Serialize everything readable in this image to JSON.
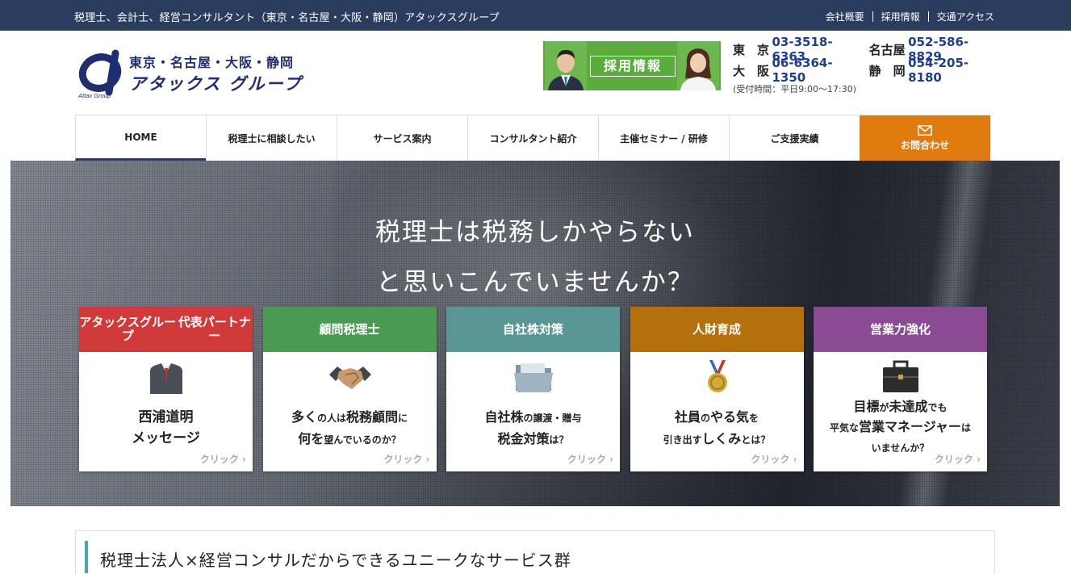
{
  "topbar": {
    "tagline": "税理士、会計士、経営コンサルタント（東京・名古屋・大阪・静岡）アタックスグループ",
    "links": [
      "会社概要",
      "採用情報",
      "交通アクセス"
    ]
  },
  "logo": {
    "mark_text": "Attax Group",
    "region": "東京・名古屋・大阪・静岡",
    "brand": "アタックス グループ"
  },
  "recruit_banner": {
    "label": "採用情報"
  },
  "contacts": {
    "rows": [
      [
        {
          "city": "東　京",
          "tel": "03-3518-6363"
        },
        {
          "city": "名古屋",
          "tel": "052-586-8829"
        }
      ],
      [
        {
          "city": "大　阪",
          "tel": "06-6364-1350"
        },
        {
          "city": "静　岡",
          "tel": "054-205-8180"
        }
      ]
    ],
    "hours": "(受付時間：平日9:00～17:30)"
  },
  "nav": {
    "items": [
      "HOME",
      "税理士に相談したい",
      "サービス案内",
      "コンサルタント紹介",
      "主催セミナー / 研修",
      "ご支援実績"
    ],
    "contact": "お問合わせ",
    "contact_icon": "mail-icon"
  },
  "hero": {
    "line1": "税理士は税務しかやらない",
    "line2": "と思いこんでいませんか？"
  },
  "cards": [
    {
      "head_lines": [
        "アタックスグループ",
        "代表パートナー"
      ],
      "color": "#d03a3a",
      "icon": "suit-icon",
      "body_html_lines": [
        [
          {
            "t": "西浦道明",
            "s": 17
          }
        ],
        [
          {
            "t": "メッセージ",
            "s": 17
          }
        ]
      ]
    },
    {
      "head_lines": [
        "顧問税理士"
      ],
      "color": "#4a9a52",
      "icon": "handshake-icon",
      "body_html_lines": [
        [
          {
            "t": "多く",
            "s": 16
          },
          {
            "t": "の人は",
            "s": 12
          },
          {
            "t": "税務顧問",
            "s": 16
          },
          {
            "t": "に",
            "s": 12
          }
        ],
        [
          {
            "t": "何を",
            "s": 16
          },
          {
            "t": "望んでいるのか？",
            "s": 12
          }
        ]
      ]
    },
    {
      "head_lines": [
        "自社株対策"
      ],
      "color": "#5a9696",
      "icon": "folder-icon",
      "body_html_lines": [
        [
          {
            "t": "自社株",
            "s": 16
          },
          {
            "t": "の譲渡・贈与",
            "s": 12
          }
        ],
        [
          {
            "t": "税金対策",
            "s": 16
          },
          {
            "t": "は？",
            "s": 12
          }
        ]
      ]
    },
    {
      "head_lines": [
        "人財育成"
      ],
      "color": "#b3700c",
      "icon": "medal-icon",
      "body_html_lines": [
        [
          {
            "t": "社員",
            "s": 16
          },
          {
            "t": "の",
            "s": 12
          },
          {
            "t": "やる気",
            "s": 16
          },
          {
            "t": "を",
            "s": 12
          }
        ],
        [
          {
            "t": "引き出す",
            "s": 12
          },
          {
            "t": "しくみ",
            "s": 16
          },
          {
            "t": "とは？",
            "s": 12
          }
        ]
      ]
    },
    {
      "head_lines": [
        "営業力強化"
      ],
      "color": "#8a4a94",
      "icon": "briefcase-icon",
      "body_html_lines": [
        [
          {
            "t": "目標",
            "s": 16
          },
          {
            "t": "が",
            "s": 12
          },
          {
            "t": "未達成",
            "s": 16
          },
          {
            "t": "でも",
            "s": 12
          }
        ],
        [
          {
            "t": "平気な",
            "s": 12
          },
          {
            "t": "営業マネージャー",
            "s": 16
          },
          {
            "t": "は",
            "s": 12
          }
        ],
        [
          {
            "t": "いませんか？",
            "s": 12
          }
        ]
      ]
    }
  ],
  "card_click": "クリック",
  "section": {
    "title": "税理士法人×経営コンサルだからできるユニークなサービス群"
  }
}
